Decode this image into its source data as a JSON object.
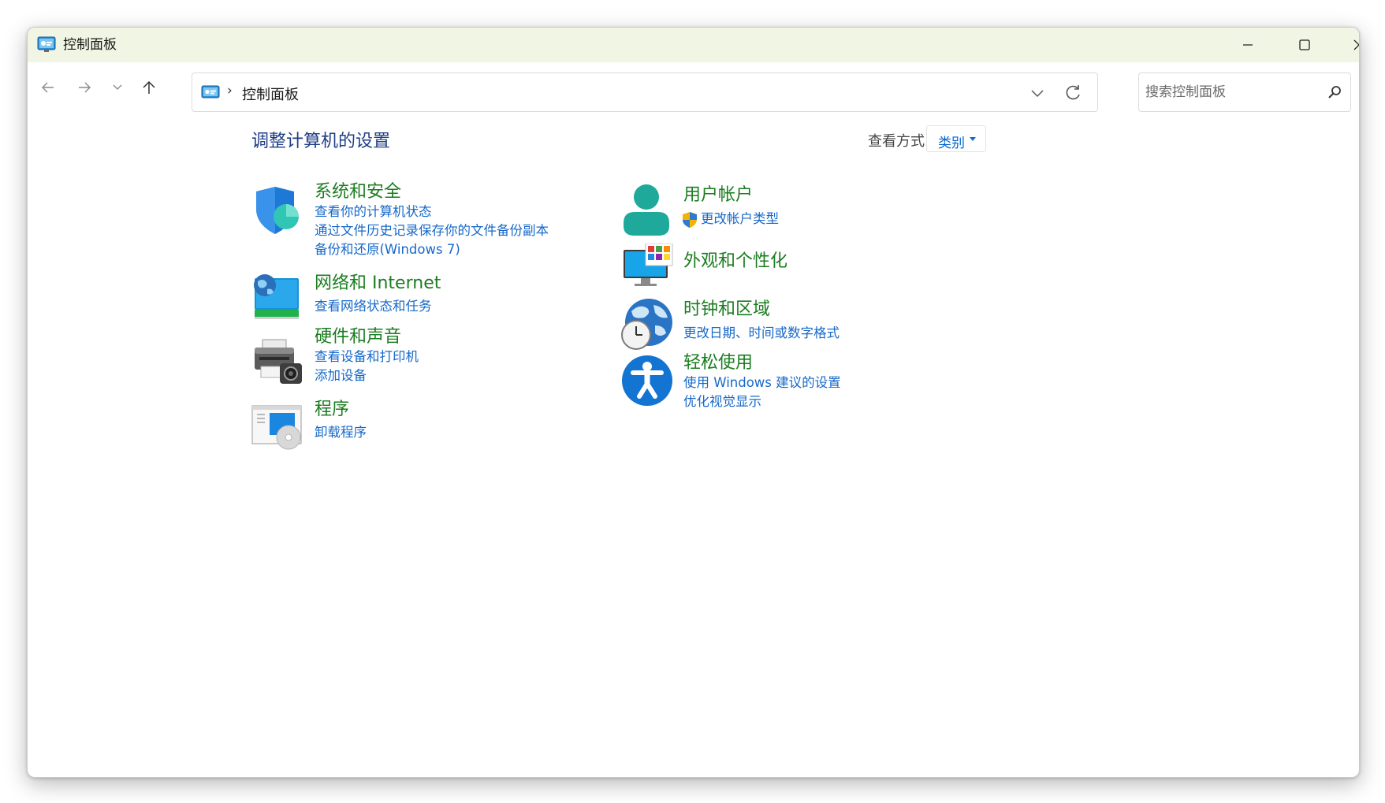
{
  "window": {
    "title": "控制面板"
  },
  "navigation": {
    "breadcrumb_separator": "›",
    "address_text": "控制面板"
  },
  "search": {
    "placeholder": "搜索控制面板"
  },
  "main": {
    "heading": "调整计算机的设置",
    "view_by_label": "查看方式:",
    "view_by_value": "类别"
  },
  "categories": {
    "system_security": {
      "title": "系统和安全",
      "links": [
        "查看你的计算机状态",
        "通过文件历史记录保存你的文件备份副本",
        "备份和还原(Windows 7)"
      ]
    },
    "network": {
      "title": "网络和 Internet",
      "links": [
        "查看网络状态和任务"
      ]
    },
    "hardware_sound": {
      "title": "硬件和声音",
      "links": [
        "查看设备和打印机",
        "添加设备"
      ]
    },
    "programs": {
      "title": "程序",
      "links": [
        "卸载程序"
      ]
    },
    "user_accounts": {
      "title": "用户帐户",
      "links": [
        "更改帐户类型"
      ]
    },
    "appearance": {
      "title": "外观和个性化",
      "links": []
    },
    "clock_region": {
      "title": "时钟和区域",
      "links": [
        "更改日期、时间或数字格式"
      ]
    },
    "ease_of_access": {
      "title": "轻松使用",
      "links": [
        "使用 Windows 建议的设置",
        "优化视觉显示"
      ]
    }
  },
  "colors": {
    "titlebar_bg": "#f1f5e3",
    "heading": "#1f3e86",
    "category_title": "#1b7d20",
    "link": "#1769c9"
  }
}
